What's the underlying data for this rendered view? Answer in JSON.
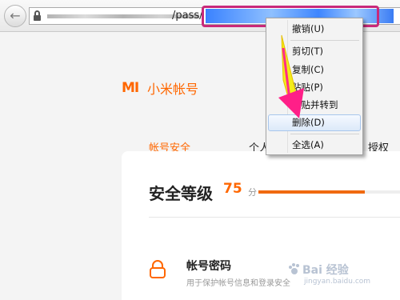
{
  "browser": {
    "url_path": "/pass/",
    "icons": {
      "back": "back-arrow-icon",
      "lock": "lock-icon"
    }
  },
  "page": {
    "brand": {
      "logo_text": "MI",
      "name": "小米帐号"
    },
    "tabs": [
      {
        "label": "帐号安全",
        "active": true
      },
      {
        "label": "个人",
        "active": false
      },
      {
        "label": "授权",
        "active": false
      }
    ],
    "security": {
      "title": "安全等级",
      "score": "75",
      "unit": "分",
      "progress": 0.75
    },
    "password": {
      "title": "帐号密码",
      "description": "用于保护帐号信息和登录安全"
    }
  },
  "context_menu": {
    "items": [
      {
        "label": "撤销(U)",
        "hover": false
      },
      {
        "label": "剪切(T)",
        "hover": false
      },
      {
        "label": "复制(C)",
        "hover": false
      },
      {
        "label": "粘贴(P)",
        "hover": false
      },
      {
        "label": "粘贴并转到",
        "hover": false
      },
      {
        "label": "删除(D)",
        "hover": true
      },
      {
        "label": "全选(A)",
        "hover": false
      }
    ]
  },
  "watermark": {
    "title": "Bai 经验",
    "subtitle": "jingyan.baidu.com"
  },
  "colors": {
    "accent": "#ff6700",
    "highlight": "#c8297a",
    "selection": "#3a82ff"
  }
}
